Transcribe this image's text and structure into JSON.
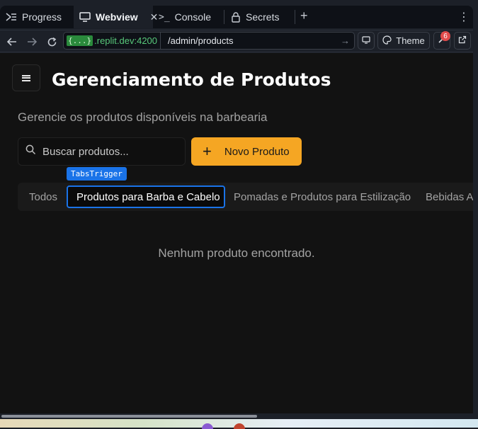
{
  "browser": {
    "tabs": [
      {
        "label": "Progress",
        "icon": "progress-icon"
      },
      {
        "label": "Webview",
        "icon": "monitor-icon"
      },
      {
        "label": "Console",
        "icon": "terminal-icon"
      },
      {
        "label": "Secrets",
        "icon": "lock-icon"
      }
    ],
    "url_badge": "{...}",
    "url_host": ".replit.dev:4200",
    "url_path": "/admin/products",
    "theme_label": "Theme",
    "notification_count": "6"
  },
  "page": {
    "title": "Gerenciamento de Produtos",
    "subtitle": "Gerencie os produtos disponíveis na barbearia",
    "search_placeholder": "Buscar produtos...",
    "new_button": "Novo Produto",
    "tooltip": "TabsTrigger",
    "categories": [
      {
        "label": "Todos",
        "active": false
      },
      {
        "label": "Produtos para Barba e Cabelo",
        "active": true
      },
      {
        "label": "Pomadas e Produtos para Estilização",
        "active": false
      },
      {
        "label": "Bebidas Alcoólicas",
        "active": false
      }
    ],
    "empty_message": "Nenhum produto encontrado."
  },
  "colors": {
    "accent": "#f5a623",
    "focus": "#1a73e8",
    "background": "#121212"
  }
}
